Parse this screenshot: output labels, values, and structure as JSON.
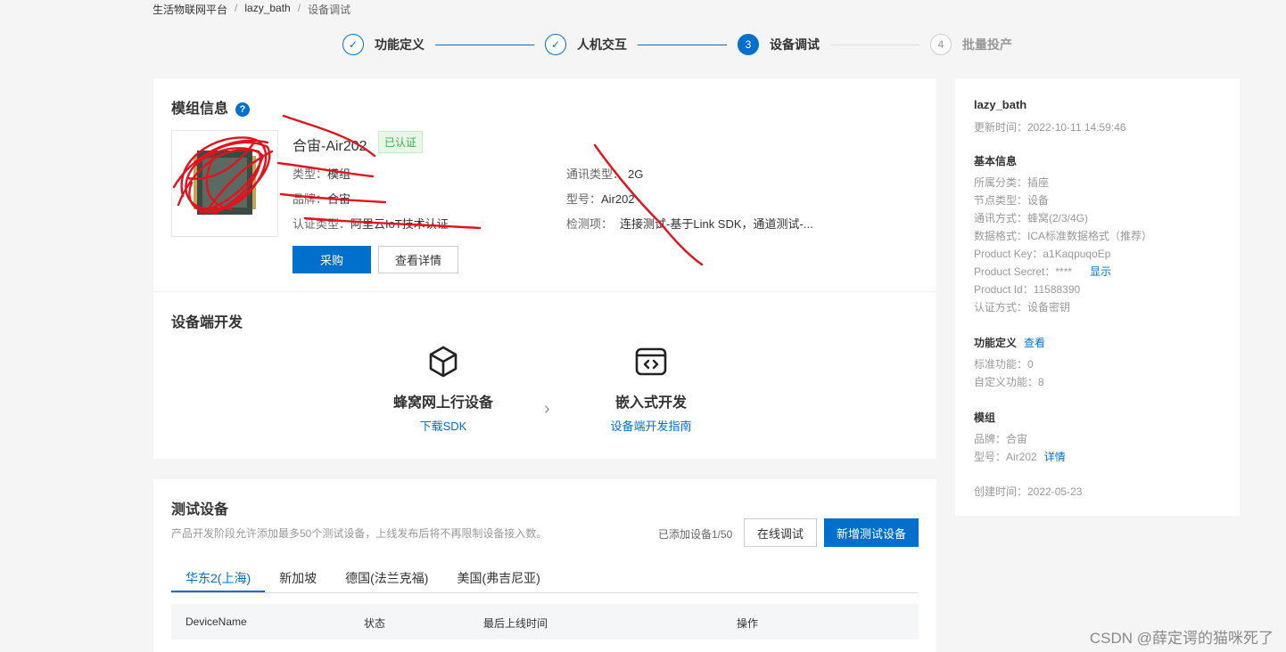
{
  "breadcrumb": {
    "root": "生活物联网平台",
    "product": "lazy_bath",
    "current": "设备调试",
    "sep": "/"
  },
  "steps": [
    {
      "num": "✓",
      "label": "功能定义",
      "state": "done"
    },
    {
      "num": "✓",
      "label": "人机交互",
      "state": "done"
    },
    {
      "num": "3",
      "label": "设备调试",
      "state": "active"
    },
    {
      "num": "4",
      "label": "批量投产",
      "state": "wait"
    }
  ],
  "module": {
    "title": "模组信息",
    "help": "?",
    "name": "合宙-Air202",
    "badge": "已认证",
    "type_label": "类型：",
    "type": "模组",
    "brand_label": "品牌：",
    "brand": "合宙",
    "cert_label": "认证类型：",
    "cert": "阿里云IoT技术认证",
    "comm_label": "通讯类型：",
    "comm": "2G",
    "model_label": "型号：",
    "model": "Air202",
    "test_label": "检测项：",
    "test": "连接测试-基于Link SDK，通道测试-...",
    "buy_button": "采购",
    "detail_button": "查看详情"
  },
  "device_dev": {
    "title": "设备端开发",
    "option1_title": "蜂窝网上行设备",
    "option1_link": "下载SDK",
    "option2_title": "嵌入式开发",
    "option2_link": "设备端开发指南"
  },
  "test_devices": {
    "title": "测试设备",
    "desc": "产品开发阶段允许添加最多50个测试设备，上线发布后将不再限制设备接入数。",
    "count": "已添加设备1/50",
    "online_debug_button": "在线调试",
    "add_button": "新增测试设备",
    "tabs": [
      "华东2(上海)",
      "新加坡",
      "德国(法兰克福)",
      "美国(弗吉尼亚)"
    ],
    "columns": [
      "DeviceName",
      "状态",
      "最后上线时间",
      "操作"
    ]
  },
  "sidebar": {
    "product_name": "lazy_bath",
    "updated": "更新时间：2022-10-11 14:59:46",
    "basic_title": "基本信息",
    "category": "所属分类：插座",
    "node_type": "节点类型：设备",
    "comm_mode": "通讯方式：蜂窝(2/3/4G)",
    "data_format": "数据格式：ICA标准数据格式（推荐）",
    "product_key": "Product Key：a1KaqpuqoEp",
    "product_secret": "Product Secret：****",
    "show_link": "显示",
    "product_id": "Product Id：11588390",
    "auth_mode": "认证方式：设备密钥",
    "func_title": "功能定义",
    "func_view_link": "查看",
    "std_func": "标准功能：0",
    "custom_func": "自定义功能：8",
    "module_title": "模组",
    "module_brand": "品牌：合宙",
    "module_model": "型号：Air202",
    "module_detail_link": "详情",
    "created": "创建时间：2022-05-23"
  },
  "watermark": "CSDN @薛定谔的猫咪死了",
  "colors": {
    "primary": "#0070cc",
    "success": "#35b34a",
    "scribble": "#e0141e"
  }
}
